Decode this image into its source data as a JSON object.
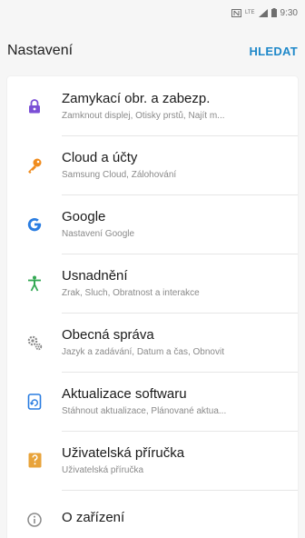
{
  "status_bar": {
    "icons": [
      "nfc-icon",
      "lte-icon",
      "signal-icon",
      "battery-icon"
    ],
    "network_label": "LTE",
    "time": "9:30"
  },
  "header": {
    "title": "Nastavení",
    "search_label": "HLEDAT"
  },
  "colors": {
    "accent": "#1e88c9",
    "lock_icon": "#7b4fd6",
    "cloud_icon": "#f08c1e",
    "google_icon": "#2a7de1",
    "accessibility_icon": "#33a853",
    "general_icon": "#8a8a8a",
    "update_icon": "#2a7de1",
    "manual_icon": "#e8a33a"
  },
  "settings": {
    "items": [
      {
        "icon": "lock-icon",
        "title": "Zamykací obr. a zabezp.",
        "subtitle": "Zamknout displej, Otisky prstů, Najít m..."
      },
      {
        "icon": "key-icon",
        "title": "Cloud a účty",
        "subtitle": "Samsung Cloud, Zálohování"
      },
      {
        "icon": "google-icon",
        "title": "Google",
        "subtitle": "Nastavení Google"
      },
      {
        "icon": "accessibility-icon",
        "title": "Usnadnění",
        "subtitle": "Zrak, Sluch, Obratnost a interakce"
      },
      {
        "icon": "gears-icon",
        "title": "Obecná správa",
        "subtitle": "Jazyk a zadávání, Datum a čas, Obnovit"
      },
      {
        "icon": "software-update-icon",
        "title": "Aktualizace softwaru",
        "subtitle": "Stáhnout aktualizace, Plánované aktua..."
      },
      {
        "icon": "user-manual-icon",
        "title": "Uživatelská příručka",
        "subtitle": "Uživatelská příručka"
      },
      {
        "icon": "info-icon",
        "title": "O zařízení",
        "subtitle": ""
      }
    ]
  }
}
